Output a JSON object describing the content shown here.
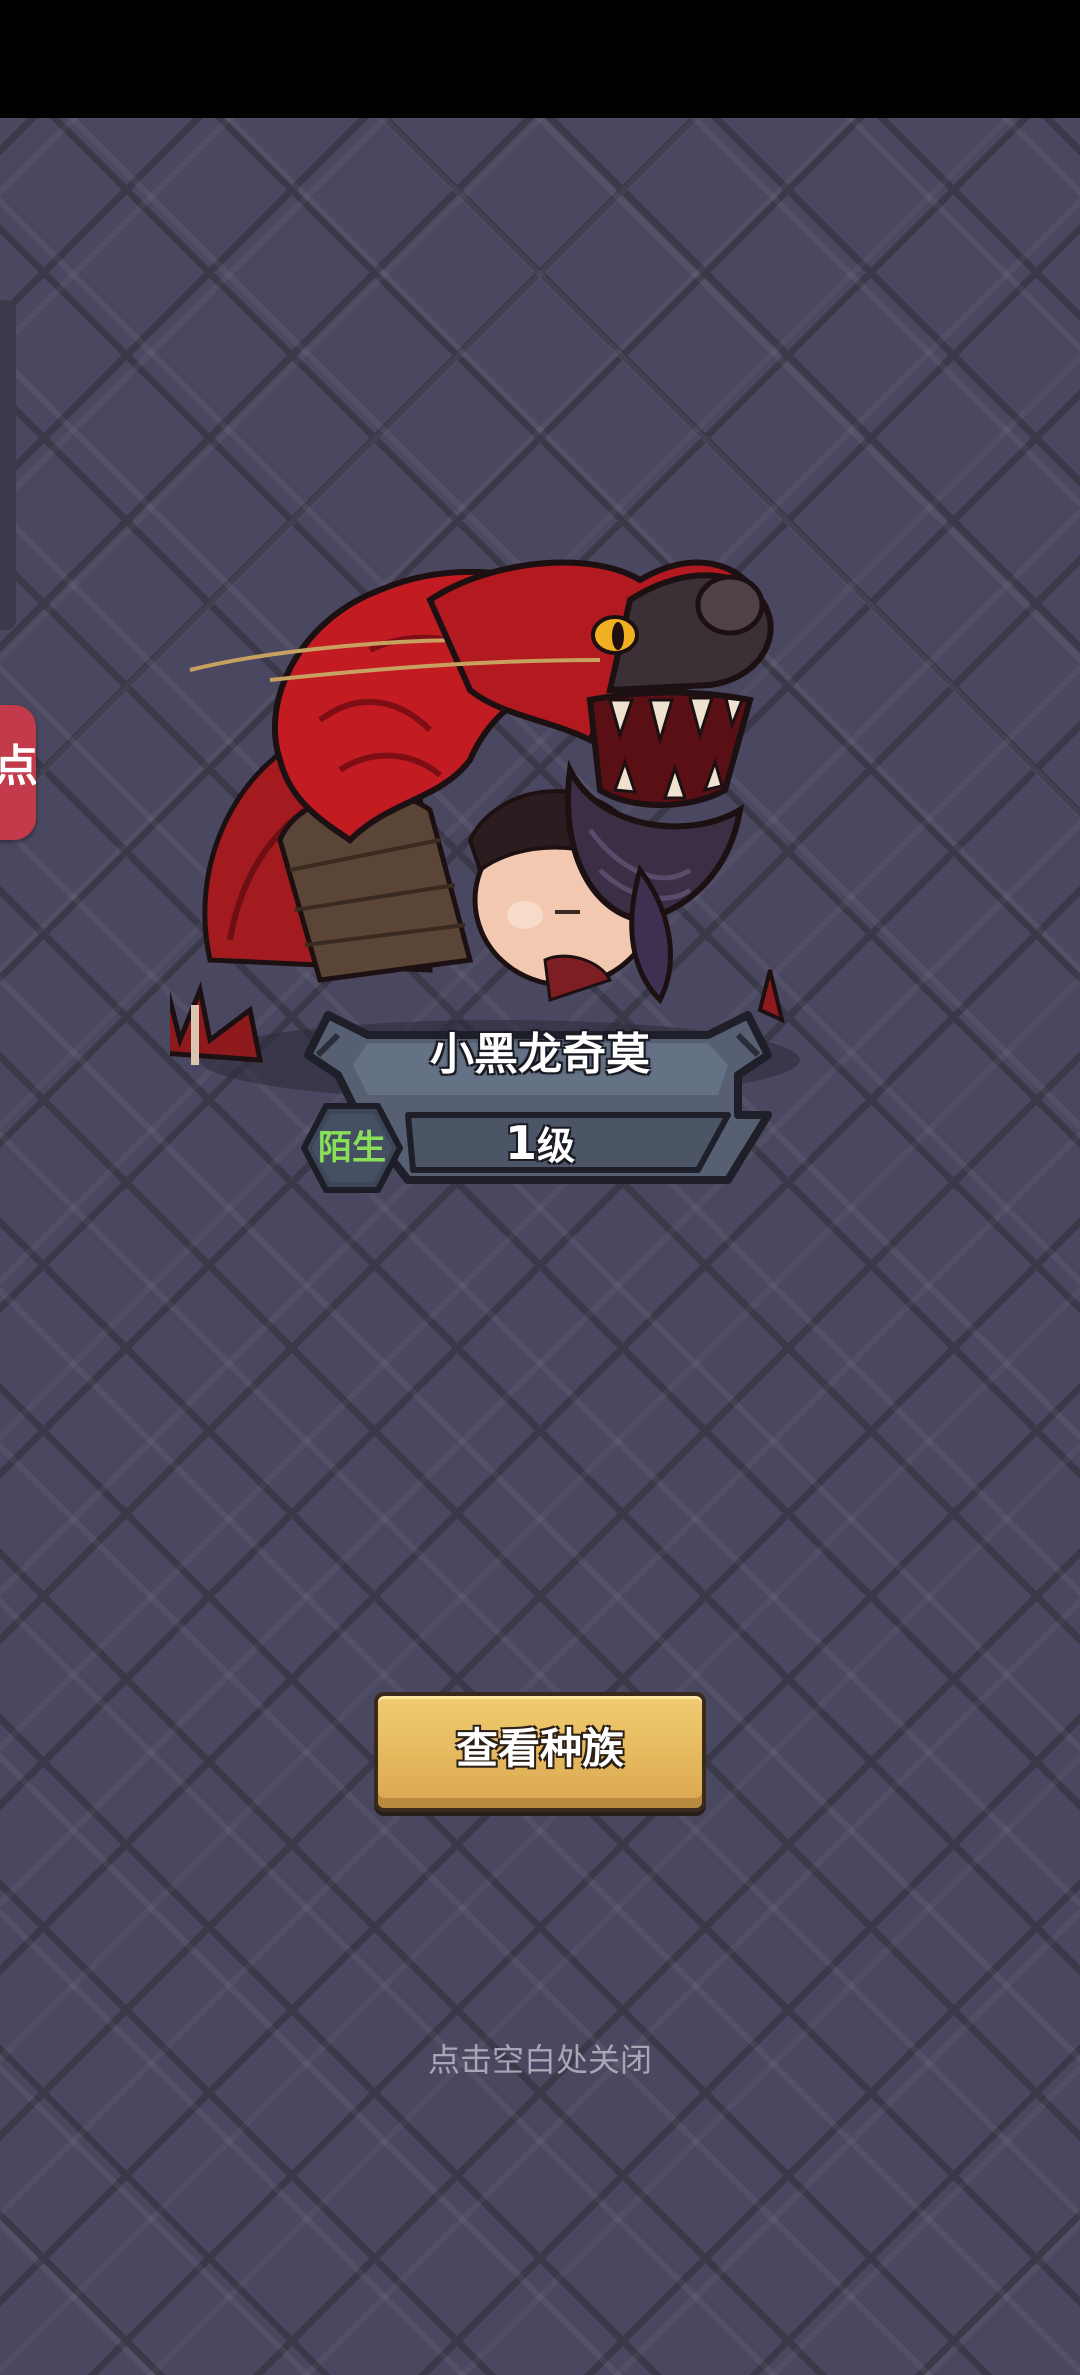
{
  "side_tab": {
    "label": "点"
  },
  "creature": {
    "name": "小黑龙奇莫",
    "level_number": "1",
    "level_unit": "级",
    "relation": "陌生"
  },
  "buttons": {
    "view_race": "查看种族"
  },
  "hint": {
    "close": "点击空白处关闭"
  },
  "colors": {
    "background": "#47445a",
    "button_gold": "#e5b85e",
    "relation_green": "#8be05a",
    "side_tab_red": "#c33a4a"
  }
}
